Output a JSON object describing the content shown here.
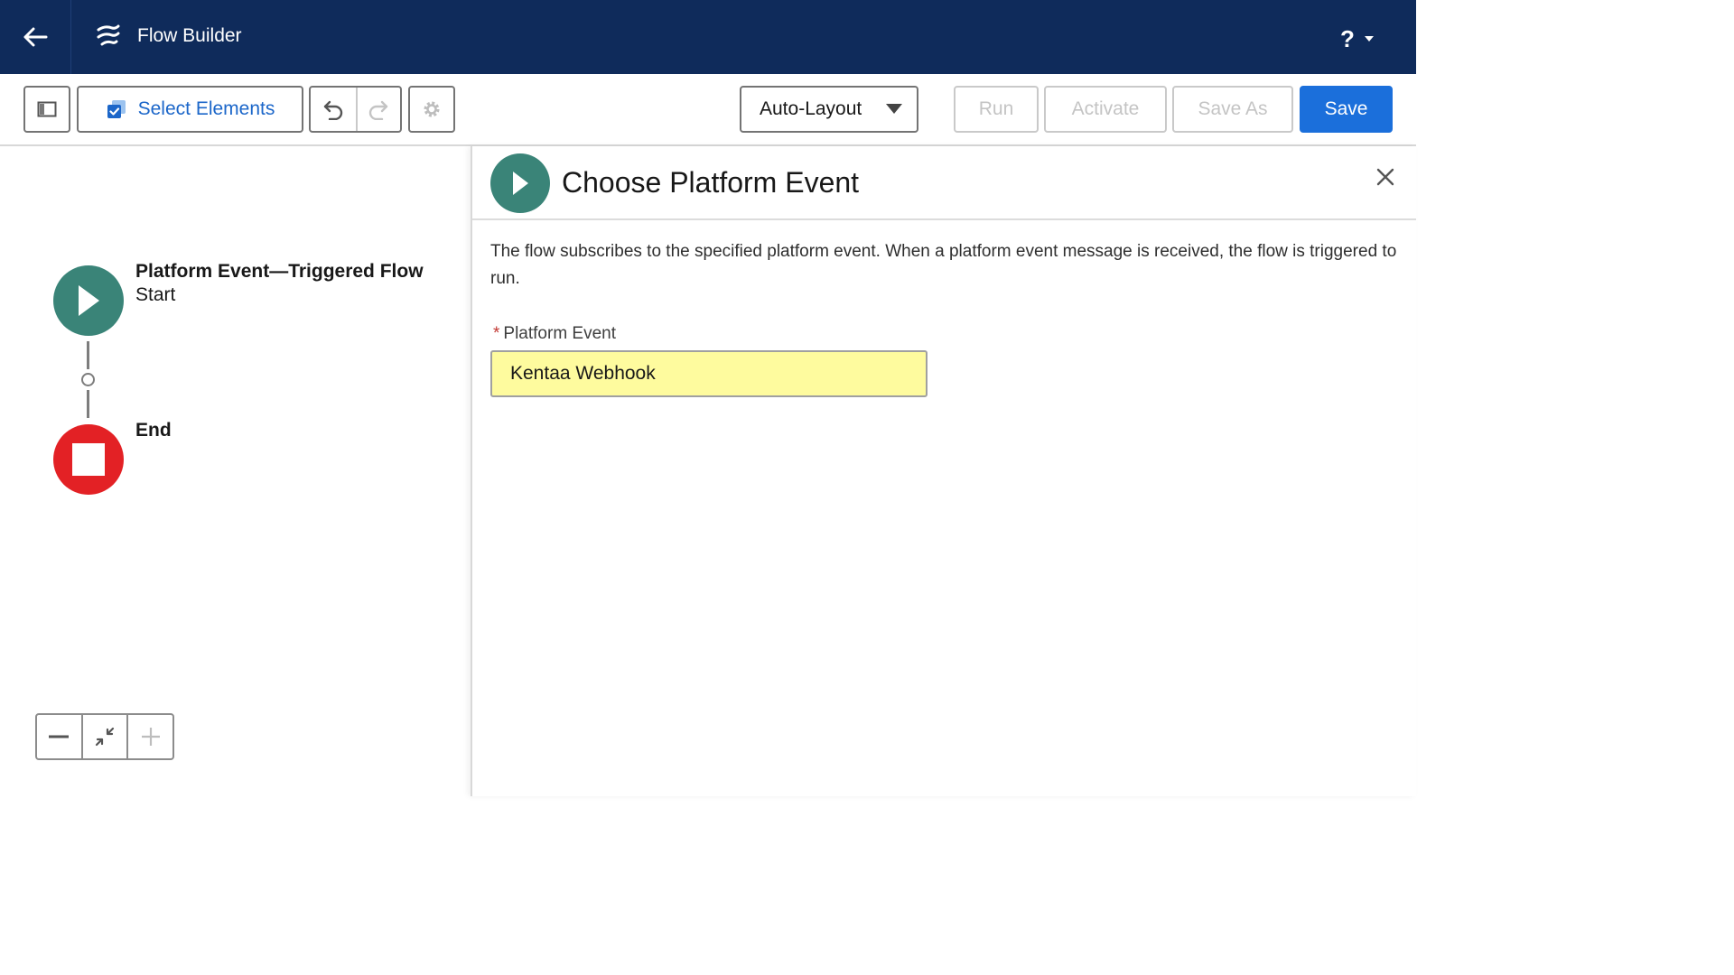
{
  "header": {
    "title": "Flow Builder",
    "help_label": "?"
  },
  "toolbar": {
    "select_elements_label": "Select Elements",
    "layout_select_value": "Auto-Layout",
    "run_label": "Run",
    "activate_label": "Activate",
    "save_as_label": "Save As",
    "save_label": "Save"
  },
  "canvas": {
    "start_node": {
      "title": "Platform Event—Triggered Flow",
      "subtitle": "Start"
    },
    "end_node": {
      "title": "End"
    }
  },
  "panel": {
    "title": "Choose Platform Event",
    "description": "The flow subscribes to the specified platform event. When a platform event message is received, the flow is triggered to run.",
    "field": {
      "required_marker": "*",
      "label": "Platform Event",
      "value": "Kentaa Webhook"
    }
  },
  "colors": {
    "header_bg": "#0f2b5b",
    "start_node": "#3a8478",
    "end_node": "#e32125",
    "primary_button": "#1b6fdb",
    "field_highlight": "#fefb9e"
  }
}
